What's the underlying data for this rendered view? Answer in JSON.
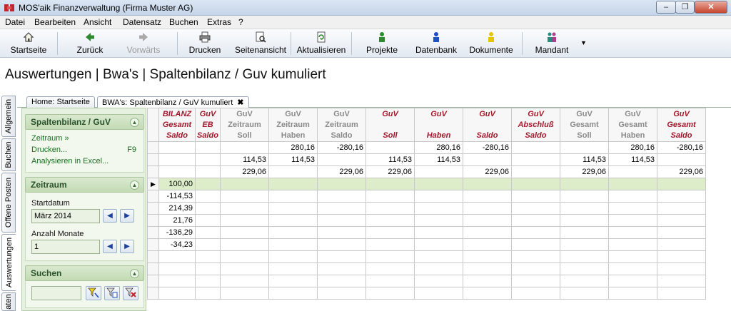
{
  "window": {
    "title": "MOS'aik Finanzverwaltung (Firma Muster AG)",
    "min_label": "–",
    "max_label": "❐",
    "close_label": "✕"
  },
  "menu": [
    "Datei",
    "Bearbeiten",
    "Ansicht",
    "Datensatz",
    "Buchen",
    "Extras",
    "?"
  ],
  "toolbar": {
    "items": [
      {
        "label": "Startseite",
        "icon": "home-icon",
        "enabled": true
      },
      {
        "label": "Zurück",
        "icon": "back-arrow-icon",
        "enabled": true
      },
      {
        "label": "Vorwärts",
        "icon": "forward-arrow-icon",
        "enabled": false
      },
      {
        "label": "Drucken",
        "icon": "printer-icon",
        "enabled": true
      },
      {
        "label": "Seitenansicht",
        "icon": "page-preview-icon",
        "enabled": true
      },
      {
        "label": "Aktualisieren",
        "icon": "refresh-icon",
        "enabled": true
      },
      {
        "label": "Projekte",
        "icon": "projects-icon",
        "enabled": true
      },
      {
        "label": "Datenbank",
        "icon": "database-icon",
        "enabled": true
      },
      {
        "label": "Dokumente",
        "icon": "documents-icon",
        "enabled": true
      },
      {
        "label": "Mandant",
        "icon": "mandant-icon",
        "enabled": true
      }
    ],
    "dropdown_arrow": "▼"
  },
  "page_title": "Auswertungen | Bwa's | Spaltenbilanz / Guv kumuliert",
  "vertical_tabs": [
    "Allgemein",
    "Buchen",
    "Offene Posten",
    "Auswertungen",
    "aten"
  ],
  "doc_tabs": [
    {
      "label": "Home: Startseite",
      "active": false
    },
    {
      "label": "BWA's: Spaltenbilanz / GuV kumuliert",
      "active": true,
      "close": "✖"
    }
  ],
  "panel": {
    "spalten": {
      "title": "Spaltenbilanz / GuV",
      "links": [
        "Zeitraum »",
        "Drucken...",
        "Analysieren in Excel..."
      ],
      "shortcut": "F9"
    },
    "zeitraum": {
      "title": "Zeitraum",
      "start_label": "Startdatum",
      "start_value": "März 2014",
      "months_label": "Anzahl Monate",
      "months_value": "1",
      "prev": "◀",
      "next": "▶"
    },
    "suchen": {
      "title": "Suchen",
      "value": ""
    },
    "collapse": "▲"
  },
  "grid": {
    "columns": [
      {
        "lines": [
          "BILANZ",
          "Gesamt",
          "Saldo"
        ],
        "style": "red"
      },
      {
        "lines": [
          "GuV",
          "EB",
          "Saldo"
        ],
        "style": "red"
      },
      {
        "lines": [
          "GuV",
          "Zeitraum",
          "Soll"
        ],
        "style": "grey"
      },
      {
        "lines": [
          "GuV",
          "Zeitraum",
          "Haben"
        ],
        "style": "grey"
      },
      {
        "lines": [
          "GuV",
          "Zeitraum",
          "Saldo"
        ],
        "style": "grey"
      },
      {
        "lines": [
          "GuV",
          "",
          "Soll"
        ],
        "style": "red"
      },
      {
        "lines": [
          "GuV",
          "",
          "Haben"
        ],
        "style": "red"
      },
      {
        "lines": [
          "GuV",
          "",
          "Saldo"
        ],
        "style": "red"
      },
      {
        "lines": [
          "GuV",
          "Abschluß",
          "Saldo"
        ],
        "style": "red"
      },
      {
        "lines": [
          "GuV",
          "Gesamt",
          "Soll"
        ],
        "style": "grey"
      },
      {
        "lines": [
          "GuV",
          "Gesamt",
          "Haben"
        ],
        "style": "grey"
      },
      {
        "lines": [
          "GuV",
          "Gesamt",
          "Saldo"
        ],
        "style": "red"
      }
    ],
    "rows": [
      [
        "",
        "",
        "",
        "280,16",
        "-280,16",
        "",
        "280,16",
        "-280,16",
        "",
        "",
        "280,16",
        "-280,16"
      ],
      [
        "",
        "",
        "114,53",
        "114,53",
        "",
        "114,53",
        "114,53",
        "",
        "",
        "114,53",
        "114,53",
        ""
      ],
      [
        "",
        "",
        "229,06",
        "",
        "229,06",
        "229,06",
        "",
        "229,06",
        "",
        "229,06",
        "",
        "229,06"
      ],
      [
        "100,00",
        "",
        "",
        "",
        "",
        "",
        "",
        "",
        "",
        "",
        "",
        ""
      ],
      [
        "-114,53",
        "",
        "",
        "",
        "",
        "",
        "",
        "",
        "",
        "",
        "",
        ""
      ],
      [
        "214,39",
        "",
        "",
        "",
        "",
        "",
        "",
        "",
        "",
        "",
        "",
        ""
      ],
      [
        "21,76",
        "",
        "",
        "",
        "",
        "",
        "",
        "",
        "",
        "",
        "",
        ""
      ],
      [
        "-136,29",
        "",
        "",
        "",
        "",
        "",
        "",
        "",
        "",
        "",
        "",
        ""
      ],
      [
        "-34,23",
        "",
        "",
        "",
        "",
        "",
        "",
        "",
        "",
        "",
        "",
        ""
      ],
      [
        "",
        "",
        "",
        "",
        "",
        "",
        "",
        "",
        "",
        "",
        "",
        ""
      ],
      [
        "",
        "",
        "",
        "",
        "",
        "",
        "",
        "",
        "",
        "",
        "",
        ""
      ],
      [
        "",
        "",
        "",
        "",
        "",
        "",
        "",
        "",
        "",
        "",
        "",
        ""
      ],
      [
        "",
        "",
        "",
        "",
        "",
        "",
        "",
        "",
        "",
        "",
        "",
        ""
      ]
    ],
    "selected_row": 3,
    "row_pointer": "▶"
  }
}
